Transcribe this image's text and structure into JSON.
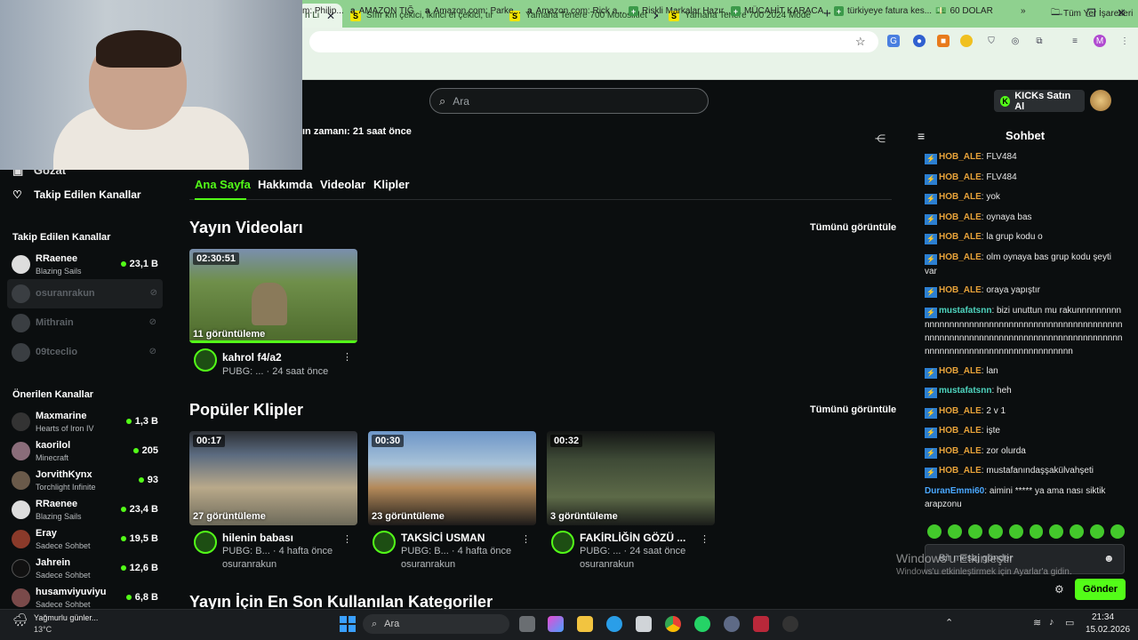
{
  "browser": {
    "tabs": [
      {
        "title": "h Li",
        "active": true
      },
      {
        "title": "Sıfır km çekici, ikinci el çekici, tır"
      },
      {
        "title": "Yamaha Tenere 700 Motosiklet"
      },
      {
        "title": "Yamaha Tenere 700 2024 Mode"
      }
    ],
    "new_tab": "+",
    "bookmarks": [
      "m: Philip...",
      "AMAZON TIĞ",
      "Amazon.com: Parke...",
      "Amazon.com: Rick a...",
      "Riskli Markalar Hazır...",
      "MÜCAHİT KARACA...",
      "türkiyeye fatura kes...",
      "60 DOLAR",
      "Tüm Yer İşaretleri"
    ],
    "profile_initial": "M"
  },
  "header": {
    "search_placeholder": "Ara",
    "kicks_button": "KICKs Satın Al",
    "last_stream": "ın zamanı: 21 saat önce"
  },
  "sidebar": {
    "top_item": "Gözat",
    "followed_link": "Takip Edilen Kanallar",
    "followed_heading": "Takip Edilen Kanallar",
    "followed": [
      {
        "name": "RRaenee",
        "game": "Blazing Sails",
        "viewers": "23,1 B",
        "live": true
      },
      {
        "name": "osuranrakun",
        "live": false
      },
      {
        "name": "Mithrain",
        "live": false
      },
      {
        "name": "09tceclio",
        "live": false
      }
    ],
    "recommended_heading": "Önerilen Kanallar",
    "recommended": [
      {
        "name": "Maxmarine",
        "game": "Hearts of Iron IV",
        "viewers": "1,3 B"
      },
      {
        "name": "kaorilol",
        "game": "Minecraft",
        "viewers": "205"
      },
      {
        "name": "JorvithKynx",
        "game": "Torchlight Infinite",
        "viewers": "93"
      },
      {
        "name": "RRaenee",
        "game": "Blazing Sails",
        "viewers": "23,4 B"
      },
      {
        "name": "Eray",
        "game": "Sadece Sohbet",
        "viewers": "19,5 B"
      },
      {
        "name": "Jahrein",
        "game": "Sadece Sohbet",
        "viewers": "12,6 B"
      },
      {
        "name": "husamviyuviyu",
        "game": "Sadece Sohbet",
        "viewers": "6,8 B"
      }
    ]
  },
  "main": {
    "tabs": [
      "Ana Sayfa",
      "Hakkımda",
      "Videolar",
      "Klipler"
    ],
    "videos_heading": "Yayın Videoları",
    "see_all": "Tümünü görüntüle",
    "videos": [
      {
        "duration": "02:30:51",
        "views": "11 görüntüleme",
        "title": "kahrol f4/a2",
        "meta": "PUBG: ... · 24 saat önce"
      }
    ],
    "clips_heading": "Popüler Klipler",
    "clips": [
      {
        "duration": "00:17",
        "views": "27 görüntüleme",
        "title": "hilenin babası",
        "meta": "PUBG: B... · 4 hafta önce",
        "channel": "osuranrakun"
      },
      {
        "duration": "00:30",
        "views": "23 görüntüleme",
        "title": "TAKSİCİ USMAN",
        "meta": "PUBG: B... · 4 hafta önce",
        "channel": "osuranrakun"
      },
      {
        "duration": "00:32",
        "views": "3 görüntüleme",
        "title": "FAKİRLİĞİN GÖZÜ ...",
        "meta": "PUBG: ... · 24 saat önce",
        "channel": "osuranrakun"
      }
    ],
    "categories_heading": "Yayın İçin En Son Kullanılan Kategoriler"
  },
  "chat": {
    "title": "Sohbet",
    "messages": [
      {
        "user": "HOB_ALE",
        "text": "FLV484"
      },
      {
        "user": "HOB_ALE",
        "text": "FLV484"
      },
      {
        "user": "HOB_ALE",
        "text": "yok"
      },
      {
        "user": "HOB_ALE",
        "text": "oynaya bas"
      },
      {
        "user": "HOB_ALE",
        "text": "la grup kodu o"
      },
      {
        "user": "HOB_ALE",
        "text": "olm oynaya bas grup kodu şeyti var"
      },
      {
        "user": "HOB_ALE",
        "text": "oraya yapıştır"
      },
      {
        "user": "mustafatsnn",
        "text": "bizi unuttun mu rakunnnnnnnnnnnnnnnnnnnnnnnnnnnnnnnnnnnnnnnnnnnnnnnnnnnnnnnnnnnnnnnnnnnnnnnnnnnnnnnnnnnnnnnnnnnnnnnnnnnnnnnnnnnnnnnnnnnnnnn"
      },
      {
        "user": "HOB_ALE",
        "text": "lan"
      },
      {
        "user": "mustafatsnn",
        "text": "heh"
      },
      {
        "user": "HOB_ALE",
        "text": "2 v 1"
      },
      {
        "user": "HOB_ALE",
        "text": "işte"
      },
      {
        "user": "HOB_ALE",
        "text": "zor olurda"
      },
      {
        "user": "HOB_ALE",
        "text": "mustafanındaşşakülvahşeti"
      },
      {
        "user": "DuranEmmi60",
        "text": "aimini ***** ya ama nası siktik arapzonu"
      }
    ],
    "input_placeholder": "Bir mesaj gönder",
    "send_button": "Gönder",
    "watermark_title": "Windows'u Etkinleştir",
    "watermark_sub": "Windows'u etkinleştirmek için Ayarlar'a gidin."
  },
  "taskbar": {
    "weather_title": "Yağmurlu günler...",
    "weather_temp": "13°C",
    "search_placeholder": "Ara",
    "time": "21:34",
    "date": "15.02.2026"
  },
  "colors": {
    "accent": "#53fc18",
    "hob_ale": "#e8a33a",
    "mustafa": "#4fd6c0",
    "duran": "#4aa8ff"
  }
}
